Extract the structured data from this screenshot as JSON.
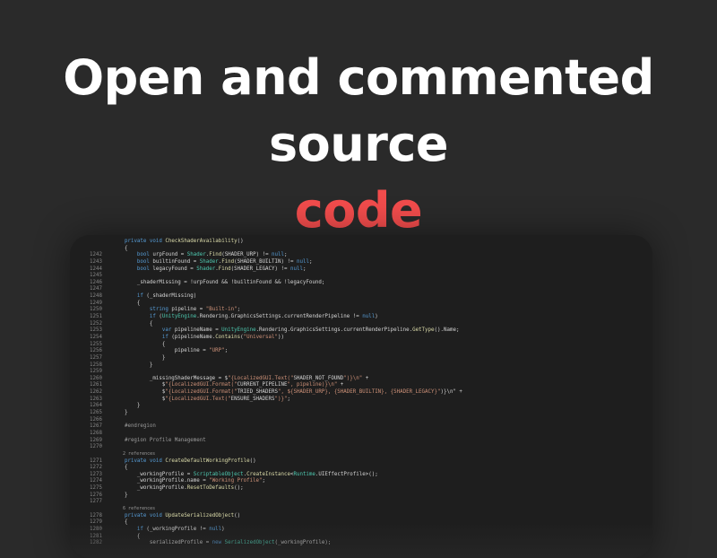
{
  "headline": {
    "line1": "Open and commented source",
    "line2": "code"
  },
  "code_lines": [
    {
      "n": "",
      "t": "    private void CheckShaderAvailability()"
    },
    {
      "n": "",
      "t": "    {"
    },
    {
      "n": "1242",
      "t": "        bool urpFound = Shader.Find(SHADER_URP) != null;"
    },
    {
      "n": "1243",
      "t": "        bool builtinFound = Shader.Find(SHADER_BUILTIN) != null;"
    },
    {
      "n": "1244",
      "t": "        bool legacyFound = Shader.Find(SHADER_LEGACY) != null;"
    },
    {
      "n": "1245",
      "t": ""
    },
    {
      "n": "1246",
      "t": "        _shaderMissing = !urpFound && !builtinFound && !legacyFound;"
    },
    {
      "n": "1247",
      "t": ""
    },
    {
      "n": "1248",
      "t": "        if (_shaderMissing)"
    },
    {
      "n": "1249",
      "t": "        {"
    },
    {
      "n": "1250",
      "t": "            string pipeline = \"Built-in\";"
    },
    {
      "n": "1251",
      "t": "            if (UnityEngine.Rendering.GraphicsSettings.currentRenderPipeline != null)"
    },
    {
      "n": "1252",
      "t": "            {"
    },
    {
      "n": "1253",
      "t": "                var pipelineName = UnityEngine.Rendering.GraphicsSettings.currentRenderPipeline.GetType().Name;"
    },
    {
      "n": "1254",
      "t": "                if (pipelineName.Contains(\"Universal\"))"
    },
    {
      "n": "1255",
      "t": "                {"
    },
    {
      "n": "1256",
      "t": "                    pipeline = \"URP\";"
    },
    {
      "n": "1257",
      "t": "                }"
    },
    {
      "n": "1258",
      "t": "            }"
    },
    {
      "n": "1259",
      "t": ""
    },
    {
      "n": "1260",
      "t": "            _missingShaderMessage = $\"{LocalizedGUI.Text(\"SHADER_NOT_FOUND\")}\\n\" +"
    },
    {
      "n": "1261",
      "t": "                $\"{LocalizedGUI.Format(\"CURRENT_PIPELINE\", pipeline)}\\n\" +"
    },
    {
      "n": "1262",
      "t": "                $\"{LocalizedGUI.Format(\"TRIED_SHADERS\", ${SHADER_URP}, {SHADER_BUILTIN}, {SHADER_LEGACY}\")}\\n\" +"
    },
    {
      "n": "1263",
      "t": "                $\"{LocalizedGUI.Text(\"ENSURE_SHADERS\")}\";"
    },
    {
      "n": "1264",
      "t": "        }"
    },
    {
      "n": "1265",
      "t": "    }"
    },
    {
      "n": "1266",
      "t": ""
    },
    {
      "n": "1267",
      "t": "    #endregion"
    },
    {
      "n": "1268",
      "t": ""
    },
    {
      "n": "1269",
      "t": "    #region Profile Management"
    },
    {
      "n": "1270",
      "t": ""
    },
    {
      "n": "",
      "t": "    2 references",
      "ref": true
    },
    {
      "n": "1271",
      "t": "    private void CreateDefaultWorkingProfile()"
    },
    {
      "n": "1272",
      "t": "    {"
    },
    {
      "n": "1273",
      "t": "        _workingProfile = ScriptableObject.CreateInstance<Runtime.UIEffectProfile>();"
    },
    {
      "n": "1274",
      "t": "        _workingProfile.name = \"Working Profile\";"
    },
    {
      "n": "1275",
      "t": "        _workingProfile.ResetToDefaults();"
    },
    {
      "n": "1276",
      "t": "    }"
    },
    {
      "n": "1277",
      "t": ""
    },
    {
      "n": "",
      "t": "    6 references",
      "ref": true
    },
    {
      "n": "1278",
      "t": "    private void UpdateSerializedObject()"
    },
    {
      "n": "1279",
      "t": "    {"
    },
    {
      "n": "1280",
      "t": "        if (_workingProfile != null)"
    },
    {
      "n": "1281",
      "t": "        {"
    },
    {
      "n": "1282",
      "t": "            serializedProfile = new SerializedObject(_workingProfile);"
    }
  ]
}
